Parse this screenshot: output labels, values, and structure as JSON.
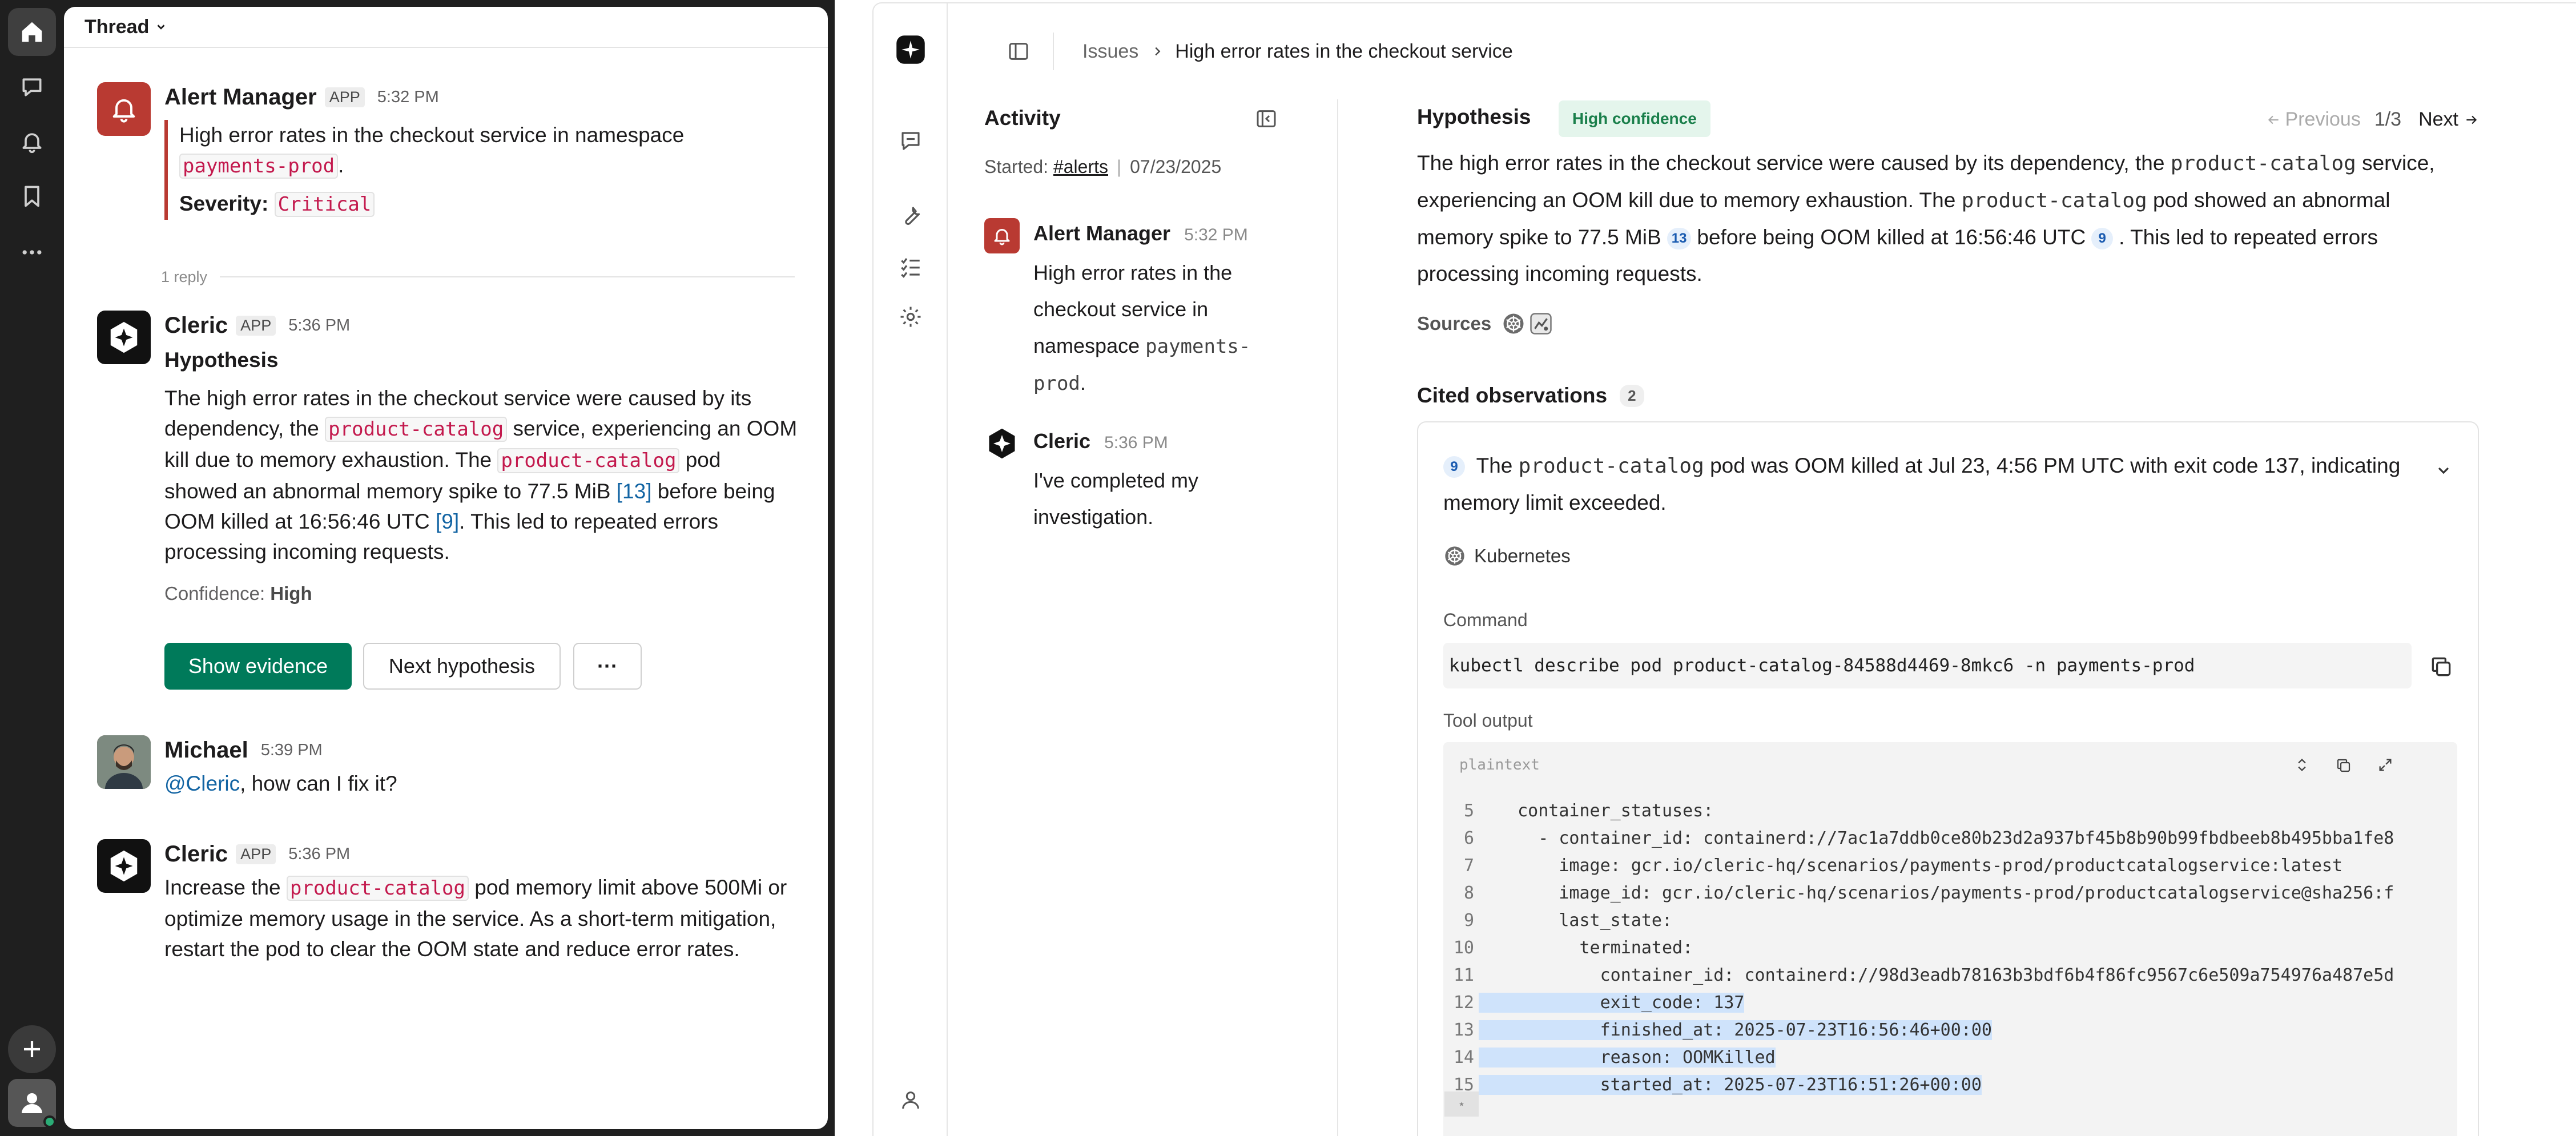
{
  "slack": {
    "thread_title": "Thread",
    "reply_count": "1 reply",
    "messages": {
      "m1": {
        "name": "Alert Manager",
        "tag": "APP",
        "time": "5:32 PM",
        "line1": "High error rates in the checkout service in namespace",
        "namespace": "payments-prod",
        "period": ".",
        "severity_label": "Severity:",
        "severity": "Critical"
      },
      "m2": {
        "name": "Cleric",
        "tag": "APP",
        "time": "5:36 PM",
        "heading": "Hypothesis",
        "t1": "The high error rates in the checkout service were caused by its dependency, the",
        "code1": "product-catalog",
        "t2": "service, experiencing an OOM kill due to memory exhaustion. The",
        "code2": "product-catalog",
        "t3": "pod showed an abnormal memory spike to 77.5 MiB",
        "ref1": "[13]",
        "t4": "before being OOM killed at 16:56:46 UTC",
        "ref2": "[9]",
        "t5": ". This led to repeated errors processing incoming requests.",
        "confidence_label": "Confidence:",
        "confidence": "High",
        "btn_evidence": "Show evidence",
        "btn_next": "Next hypothesis",
        "btn_more": "···"
      },
      "m3": {
        "name": "Michael",
        "time": "5:39 PM",
        "mention": "@Cleric",
        "text": ", how can I fix it?"
      },
      "m4": {
        "name": "Cleric",
        "tag": "APP",
        "time": "5:36 PM",
        "t1": "Increase the",
        "code1": "product-catalog",
        "t2": "pod memory limit above 500Mi or optimize memory usage in the service. As a short-term mitigation, restart the pod to clear the OOM state and reduce error rates."
      }
    }
  },
  "cleric": {
    "breadcrumb": {
      "root": "Issues",
      "current": "High error rates in the checkout service"
    },
    "activity": {
      "title": "Activity",
      "started_label": "Started:",
      "channel": "#alerts",
      "divider": "|",
      "date": "07/23/2025",
      "items": [
        {
          "name": "Alert Manager",
          "time": "5:32 PM",
          "text": "High error rates in the checkout service in namespace",
          "code": "payments-prod",
          "end": "."
        },
        {
          "name": "Cleric",
          "time": "5:36 PM",
          "text": "I've completed my investigation."
        }
      ]
    },
    "hypothesis": {
      "title": "Hypothesis",
      "badge": "High confidence",
      "prev": "Previous",
      "page": "1/3",
      "next": "Next",
      "t1": "The high error rates in the checkout service were caused by its dependency, the",
      "code1": "product-catalog",
      "t2": "service, experiencing an OOM kill due to memory exhaustion. The",
      "code2": "product-catalog",
      "t3": "pod showed an abnormal memory spike to 77.5 MiB",
      "cite1": "13",
      "t4": "before being OOM killed at 16:56:46 UTC",
      "cite2": "9",
      "t5": ". This led to repeated errors processing incoming requests.",
      "sources_label": "Sources"
    },
    "observations": {
      "title": "Cited observations",
      "count": "2",
      "item": {
        "cite": "9",
        "t1": "The",
        "code": "product-catalog",
        "t2": "pod was OOM killed at Jul 23, 4:56 PM UTC with exit code 137, indicating memory limit exceeded.",
        "source": "Kubernetes",
        "command_label": "Command",
        "command": "kubectl describe pod product-catalog-84588d4469-8mkc6 -n payments-prod",
        "output_label": "Tool output",
        "lang": "plaintext",
        "lines": [
          {
            "n": "5",
            "text": "  container_statuses:",
            "hl": false
          },
          {
            "n": "6",
            "text": "    - container_id: containerd://7ac1a7ddb0ce80b23d2a937bf45b8b90b99fbdbeeb8b495bba1fe8",
            "hl": false
          },
          {
            "n": "7",
            "text": "      image: gcr.io/cleric-hq/scenarios/payments-prod/productcatalogservice:latest",
            "hl": false
          },
          {
            "n": "8",
            "text": "      image_id: gcr.io/cleric-hq/scenarios/payments-prod/productcatalogservice@sha256:f",
            "hl": false
          },
          {
            "n": "9",
            "text": "      last_state:",
            "hl": false
          },
          {
            "n": "10",
            "text": "        terminated:",
            "hl": false
          },
          {
            "n": "11",
            "text": "          container_id: containerd://98d3eadb78163b3bdf6b4f86fc9567c6e509a754976a487e5d",
            "hl": false
          },
          {
            "n": "12",
            "text": "          exit_code: 137",
            "hl": true
          },
          {
            "n": "13",
            "text": "          finished_at: 2025-07-23T16:56:46+00:00",
            "hl": true
          },
          {
            "n": "14",
            "text": "          reason: OOMKilled",
            "hl": true
          },
          {
            "n": "15",
            "text": "          started_at: 2025-07-23T16:51:26+00:00",
            "hl": true
          }
        ]
      }
    }
  },
  "colors": {
    "alert_red": "#b93a32",
    "slack_green": "#007a5a",
    "code_red": "#c3194d",
    "link_blue": "#1264a3",
    "highlight_blue": "#cfe3fb"
  }
}
